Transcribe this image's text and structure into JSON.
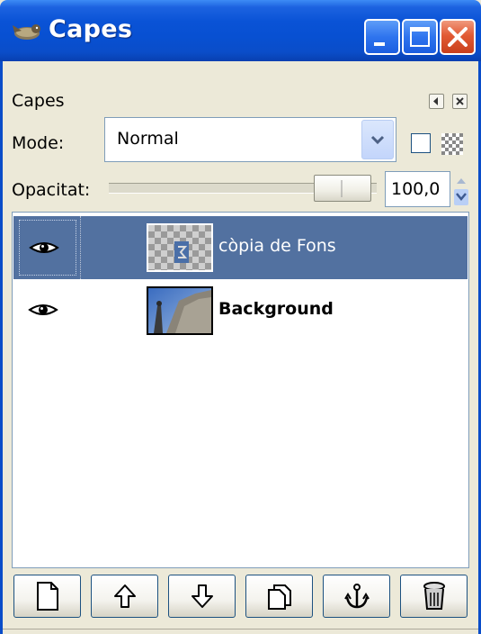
{
  "window": {
    "title": "Capes"
  },
  "panel": {
    "header": "Capes",
    "mode_label": "Mode:",
    "mode_value": "Normal",
    "opacity_label": "Opacitat:",
    "opacity_value": "100,0"
  },
  "layers": [
    {
      "name": "còpia de Fons",
      "visible": true,
      "selected": true,
      "bold": false
    },
    {
      "name": "Background",
      "visible": true,
      "selected": false,
      "bold": true
    }
  ],
  "buttons": [
    {
      "icon": "new-layer-icon"
    },
    {
      "icon": "raise-layer-icon"
    },
    {
      "icon": "lower-layer-icon"
    },
    {
      "icon": "duplicate-layer-icon"
    },
    {
      "icon": "anchor-layer-icon"
    },
    {
      "icon": "delete-layer-icon"
    }
  ],
  "colors": {
    "titlebar": "#0a53d6",
    "selection": "#5271a0",
    "close": "#e25a34"
  }
}
